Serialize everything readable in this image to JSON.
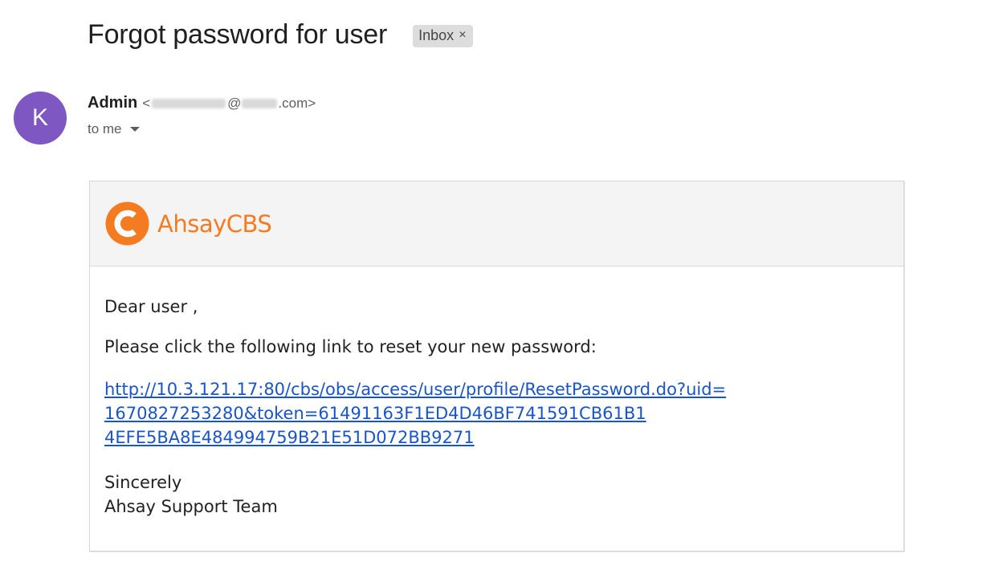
{
  "email": {
    "subject": "Forgot password for user",
    "label": "Inbox",
    "label_close": "×",
    "sender": {
      "avatar_letter": "K",
      "avatar_color": "#7e57c2",
      "name": "Admin",
      "email_open": "<",
      "email_at": "@",
      "email_domain_suffix": ".com>"
    },
    "recipient": "to me"
  },
  "message": {
    "brand_name": "AhsayCBS",
    "brand_color": "#f47b20",
    "greeting": "Dear user ,",
    "instruction": "Please click the following link to reset your new password:",
    "link_lines": [
      "http://10.3.121.17:80/cbs/obs/access/user/profile/ResetPassword.do?uid=",
      "1670827253280&token=61491163F1ED4D46BF741591CB61B1",
      "4EFE5BA8E484994759B21E51D072BB9271"
    ],
    "closing": "Sincerely",
    "signature": "Ahsay Support Team"
  }
}
